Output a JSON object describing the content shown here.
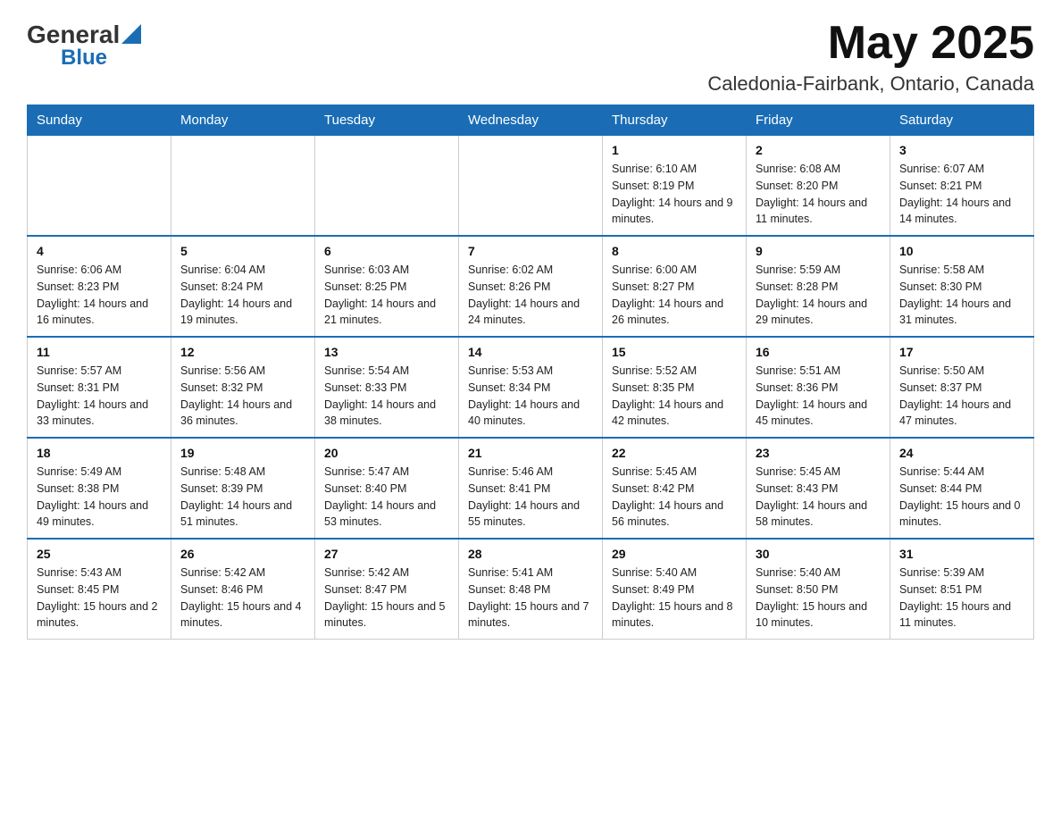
{
  "header": {
    "logo_general": "General",
    "logo_blue": "Blue",
    "month": "May 2025",
    "location": "Caledonia-Fairbank, Ontario, Canada"
  },
  "weekdays": [
    "Sunday",
    "Monday",
    "Tuesday",
    "Wednesday",
    "Thursday",
    "Friday",
    "Saturday"
  ],
  "weeks": [
    [
      {
        "day": "",
        "info": ""
      },
      {
        "day": "",
        "info": ""
      },
      {
        "day": "",
        "info": ""
      },
      {
        "day": "",
        "info": ""
      },
      {
        "day": "1",
        "info": "Sunrise: 6:10 AM\nSunset: 8:19 PM\nDaylight: 14 hours and 9 minutes."
      },
      {
        "day": "2",
        "info": "Sunrise: 6:08 AM\nSunset: 8:20 PM\nDaylight: 14 hours and 11 minutes."
      },
      {
        "day": "3",
        "info": "Sunrise: 6:07 AM\nSunset: 8:21 PM\nDaylight: 14 hours and 14 minutes."
      }
    ],
    [
      {
        "day": "4",
        "info": "Sunrise: 6:06 AM\nSunset: 8:23 PM\nDaylight: 14 hours and 16 minutes."
      },
      {
        "day": "5",
        "info": "Sunrise: 6:04 AM\nSunset: 8:24 PM\nDaylight: 14 hours and 19 minutes."
      },
      {
        "day": "6",
        "info": "Sunrise: 6:03 AM\nSunset: 8:25 PM\nDaylight: 14 hours and 21 minutes."
      },
      {
        "day": "7",
        "info": "Sunrise: 6:02 AM\nSunset: 8:26 PM\nDaylight: 14 hours and 24 minutes."
      },
      {
        "day": "8",
        "info": "Sunrise: 6:00 AM\nSunset: 8:27 PM\nDaylight: 14 hours and 26 minutes."
      },
      {
        "day": "9",
        "info": "Sunrise: 5:59 AM\nSunset: 8:28 PM\nDaylight: 14 hours and 29 minutes."
      },
      {
        "day": "10",
        "info": "Sunrise: 5:58 AM\nSunset: 8:30 PM\nDaylight: 14 hours and 31 minutes."
      }
    ],
    [
      {
        "day": "11",
        "info": "Sunrise: 5:57 AM\nSunset: 8:31 PM\nDaylight: 14 hours and 33 minutes."
      },
      {
        "day": "12",
        "info": "Sunrise: 5:56 AM\nSunset: 8:32 PM\nDaylight: 14 hours and 36 minutes."
      },
      {
        "day": "13",
        "info": "Sunrise: 5:54 AM\nSunset: 8:33 PM\nDaylight: 14 hours and 38 minutes."
      },
      {
        "day": "14",
        "info": "Sunrise: 5:53 AM\nSunset: 8:34 PM\nDaylight: 14 hours and 40 minutes."
      },
      {
        "day": "15",
        "info": "Sunrise: 5:52 AM\nSunset: 8:35 PM\nDaylight: 14 hours and 42 minutes."
      },
      {
        "day": "16",
        "info": "Sunrise: 5:51 AM\nSunset: 8:36 PM\nDaylight: 14 hours and 45 minutes."
      },
      {
        "day": "17",
        "info": "Sunrise: 5:50 AM\nSunset: 8:37 PM\nDaylight: 14 hours and 47 minutes."
      }
    ],
    [
      {
        "day": "18",
        "info": "Sunrise: 5:49 AM\nSunset: 8:38 PM\nDaylight: 14 hours and 49 minutes."
      },
      {
        "day": "19",
        "info": "Sunrise: 5:48 AM\nSunset: 8:39 PM\nDaylight: 14 hours and 51 minutes."
      },
      {
        "day": "20",
        "info": "Sunrise: 5:47 AM\nSunset: 8:40 PM\nDaylight: 14 hours and 53 minutes."
      },
      {
        "day": "21",
        "info": "Sunrise: 5:46 AM\nSunset: 8:41 PM\nDaylight: 14 hours and 55 minutes."
      },
      {
        "day": "22",
        "info": "Sunrise: 5:45 AM\nSunset: 8:42 PM\nDaylight: 14 hours and 56 minutes."
      },
      {
        "day": "23",
        "info": "Sunrise: 5:45 AM\nSunset: 8:43 PM\nDaylight: 14 hours and 58 minutes."
      },
      {
        "day": "24",
        "info": "Sunrise: 5:44 AM\nSunset: 8:44 PM\nDaylight: 15 hours and 0 minutes."
      }
    ],
    [
      {
        "day": "25",
        "info": "Sunrise: 5:43 AM\nSunset: 8:45 PM\nDaylight: 15 hours and 2 minutes."
      },
      {
        "day": "26",
        "info": "Sunrise: 5:42 AM\nSunset: 8:46 PM\nDaylight: 15 hours and 4 minutes."
      },
      {
        "day": "27",
        "info": "Sunrise: 5:42 AM\nSunset: 8:47 PM\nDaylight: 15 hours and 5 minutes."
      },
      {
        "day": "28",
        "info": "Sunrise: 5:41 AM\nSunset: 8:48 PM\nDaylight: 15 hours and 7 minutes."
      },
      {
        "day": "29",
        "info": "Sunrise: 5:40 AM\nSunset: 8:49 PM\nDaylight: 15 hours and 8 minutes."
      },
      {
        "day": "30",
        "info": "Sunrise: 5:40 AM\nSunset: 8:50 PM\nDaylight: 15 hours and 10 minutes."
      },
      {
        "day": "31",
        "info": "Sunrise: 5:39 AM\nSunset: 8:51 PM\nDaylight: 15 hours and 11 minutes."
      }
    ]
  ]
}
